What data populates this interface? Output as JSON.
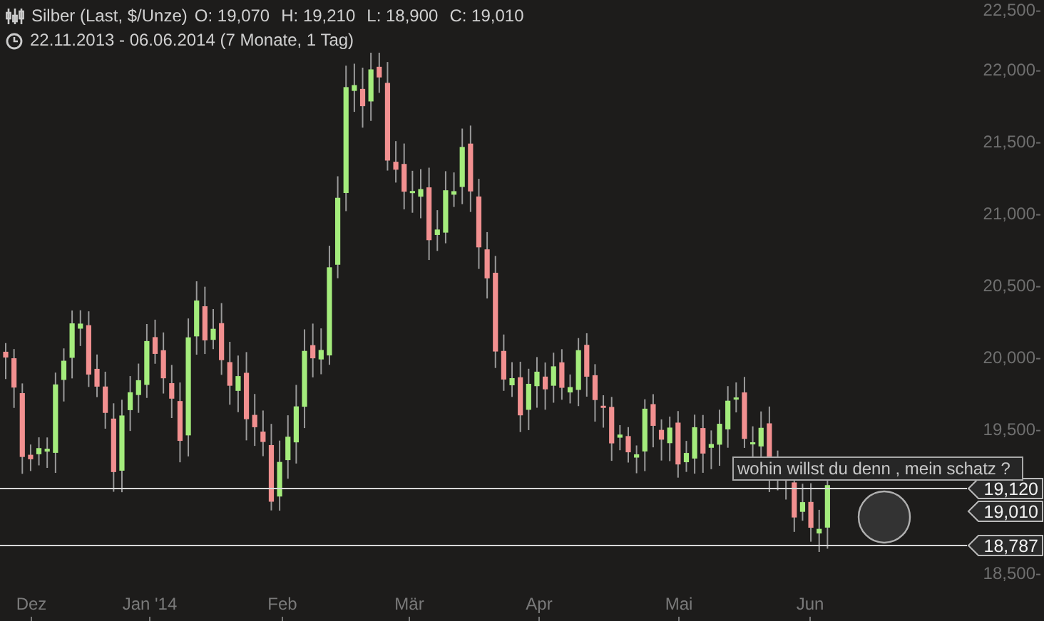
{
  "header": {
    "title": "Silber (Last, $/Unze)",
    "open": "O: 19,070",
    "high": "H: 19,210",
    "low": "L: 18,900",
    "close": "C: 19,010",
    "range": "22.11.2013 - 06.06.2014 (7 Monate, 1 Tag)"
  },
  "y_axis": {
    "ticks": [
      "22,500-",
      "22,000-",
      "21,500-",
      "21,000-",
      "20,500-",
      "20,000-",
      "19,500-",
      "18,500-"
    ]
  },
  "x_axis": {
    "ticks": [
      "Dez",
      "Jan '14",
      "Feb",
      "Mär",
      "Apr",
      "Mai",
      "Jun"
    ]
  },
  "price_tags": [
    {
      "label": "19,120",
      "kind": "line"
    },
    {
      "label": "19,010",
      "kind": "tag"
    },
    {
      "label": "18,787",
      "kind": "line"
    }
  ],
  "annotation": {
    "text": "wohin willst du denn , mein schatz ?"
  }
}
